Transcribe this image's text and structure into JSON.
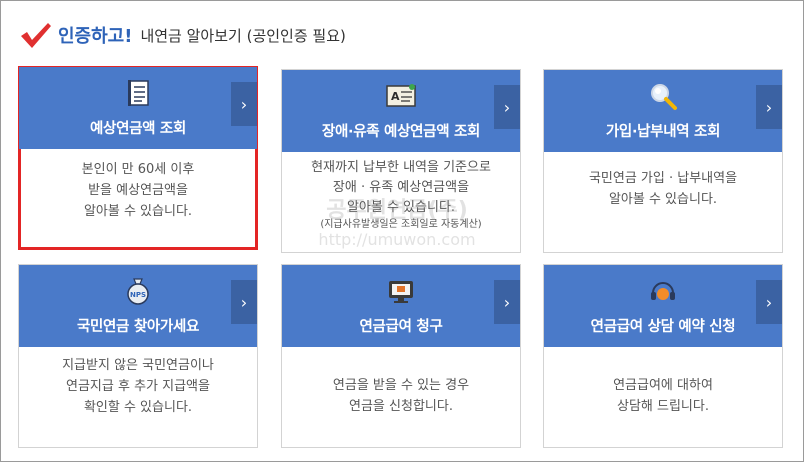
{
  "header": {
    "strong_text": "인증하고!",
    "sub_text": "내연금 알아보기 (공인인증 필요)"
  },
  "cards": [
    {
      "title": "예상연금액 조회",
      "description": [
        "본인이 만 60세 이후",
        "받을 예상연금액을",
        "알아볼 수 있습니다."
      ],
      "note": "",
      "icon": "document-list-icon",
      "selected": true
    },
    {
      "title": "장애·유족 예상연금액 조회",
      "description": [
        "현재까지 납부한 내역을 기준으로",
        "장애 · 유족 예상연금액을",
        "알아볼 수 있습니다."
      ],
      "note": "(지급사유발생일은 조회일로 자동계산)",
      "icon": "id-card-icon",
      "selected": false
    },
    {
      "title": "가입·납부내역 조회",
      "description": [
        "국민연금 가입 · 납부내역을",
        "알아볼 수 있습니다."
      ],
      "note": "",
      "icon": "magnifier-icon",
      "selected": false
    },
    {
      "title": "국민연금 찾아가세요",
      "description": [
        "지급받지 않은 국민연금이나",
        "연금지급 후 추가 지급액을",
        "확인할 수 있습니다."
      ],
      "note": "",
      "icon": "nps-money-bag-icon",
      "selected": false
    },
    {
      "title": "연금급여 청구",
      "description": [
        "연금을 받을 수 있는 경우",
        "연금을 신청합니다."
      ],
      "note": "",
      "icon": "monitor-icon",
      "selected": false
    },
    {
      "title": "연금급여 상담 예약 신청",
      "description": [
        "연금급여에 대하여",
        "상담해 드립니다."
      ],
      "note": "",
      "icon": "headset-icon",
      "selected": false
    }
  ],
  "watermark": {
    "text": "공무원연금(주)",
    "url": "http://umuwon.com"
  },
  "colors": {
    "card_header": "#4a7ac9",
    "arrow_bg": "#3b62a3",
    "selected_border": "#e32525",
    "header_strong": "#2e63b8",
    "check": "#e03030"
  }
}
